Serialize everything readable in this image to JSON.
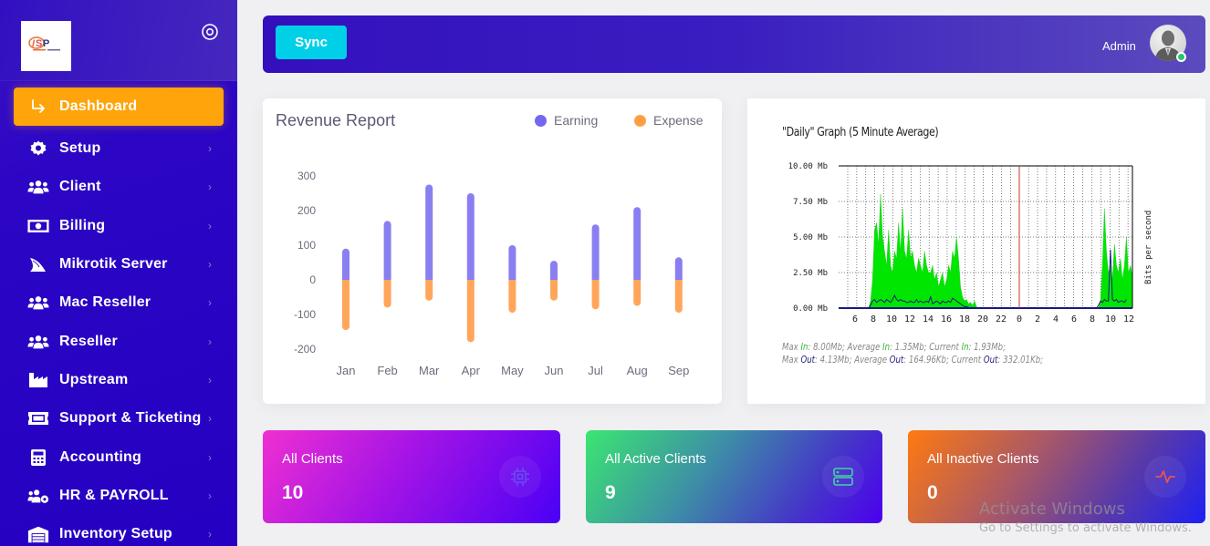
{
  "sidebar": {
    "logo_alt": "ISP Digital BD",
    "logo_text": "ISP",
    "items": [
      {
        "label": "Dashboard",
        "icon": "arrow-turn-down-right-icon",
        "active": true
      },
      {
        "label": "Setup",
        "icon": "gear-icon",
        "active": false
      },
      {
        "label": "Client",
        "icon": "users-icon",
        "active": false
      },
      {
        "label": "Billing",
        "icon": "money-bill-icon",
        "active": false
      },
      {
        "label": "Mikrotik Server",
        "icon": "sail-icon",
        "active": false
      },
      {
        "label": "Mac Reseller",
        "icon": "users-icon",
        "active": false
      },
      {
        "label": "Reseller",
        "icon": "users-icon",
        "active": false
      },
      {
        "label": "Upstream",
        "icon": "industry-icon",
        "active": false
      },
      {
        "label": "Support & Ticketing",
        "icon": "ticket-icon",
        "active": false
      },
      {
        "label": "Accounting",
        "icon": "calculator-icon",
        "active": false
      },
      {
        "label": "HR & PAYROLL",
        "icon": "users-cog-icon",
        "active": false
      },
      {
        "label": "Inventory Setup",
        "icon": "warehouse-icon",
        "active": false
      }
    ],
    "chevron": "›"
  },
  "topbar": {
    "sync_label": "Sync",
    "user_name": "Admin",
    "user_status": "online",
    "status_color": "#28c76f"
  },
  "revenue": {
    "title": "Revenue Report",
    "legend": [
      {
        "label": "Earning",
        "color": "#7367f0"
      },
      {
        "label": "Expense",
        "color": "#ff9f43"
      }
    ]
  },
  "chart_data": [
    {
      "type": "bar",
      "title": "Revenue Report",
      "xlabel": "",
      "ylabel": "",
      "categories": [
        "Jan",
        "Feb",
        "Mar",
        "Apr",
        "May",
        "Jun",
        "Jul",
        "Aug",
        "Sep"
      ],
      "series": [
        {
          "name": "Earning",
          "color": "#8a7ff0",
          "values": [
            90,
            170,
            275,
            250,
            100,
            55,
            160,
            210,
            65
          ]
        },
        {
          "name": "Expense",
          "color": "#ffa65b",
          "values": [
            -145,
            -80,
            -60,
            -180,
            -95,
            -60,
            -85,
            -75,
            -95
          ]
        }
      ],
      "yticks": [
        300,
        200,
        100,
        0,
        -100,
        -200
      ],
      "ylim": [
        -200,
        300
      ],
      "stacked": true,
      "grid": false,
      "legend": "top-right"
    },
    {
      "type": "area",
      "title": "\"Daily\" Graph (5 Minute Average)",
      "ylabel": "Bits per second",
      "yticks": [
        "10.00 Mb",
        "7.50 Mb",
        "5.00 Mb",
        "2.50 Mb",
        "0.00 Mb"
      ],
      "ylim": [
        0,
        10
      ],
      "xticks": [
        "6",
        "8",
        "10",
        "12",
        "14",
        "16",
        "18",
        "20",
        "22",
        "0",
        "2",
        "4",
        "6",
        "8",
        "10",
        "12"
      ],
      "grid": true,
      "marker_at": "0",
      "series": [
        {
          "name": "In",
          "color": "#00e600",
          "unit": "Mb",
          "values": [
            0,
            0,
            0,
            0,
            0,
            0,
            0,
            0,
            0,
            0,
            0,
            0,
            0,
            0,
            0,
            0,
            0.5,
            2,
            5.5,
            6,
            4.5,
            8,
            5,
            4,
            3,
            5.5,
            3,
            2.5,
            4,
            3.5,
            6,
            4,
            7,
            4,
            3.5,
            5.5,
            3.5,
            4,
            3,
            2.5,
            3.5,
            3,
            2.5,
            4,
            3,
            2.5,
            2.5,
            3,
            2,
            2.5,
            1.5,
            2,
            2.5,
            1.5,
            2,
            3,
            2.5,
            4,
            3.5,
            5,
            3.5,
            1.5,
            0.8,
            0.5,
            0.6,
            0.3,
            0.4,
            0.2,
            0.5,
            0.1,
            0,
            0,
            0,
            0,
            0,
            0,
            0,
            0,
            0,
            0,
            0,
            0,
            0,
            0,
            0,
            0,
            0,
            0,
            0,
            0,
            0,
            0,
            0,
            0,
            0,
            0,
            0,
            0,
            0,
            0,
            0,
            0,
            0,
            0,
            0,
            0,
            0,
            0,
            0,
            0,
            0,
            0,
            0,
            0,
            0,
            0,
            0,
            0,
            0,
            0,
            0,
            0,
            0,
            0,
            0,
            0,
            0,
            0,
            0,
            0,
            0,
            0.5,
            3,
            7,
            4,
            2.5,
            3,
            2,
            4.5,
            3,
            2.5,
            3.5,
            2,
            3,
            5,
            2.5,
            3,
            2.2
          ]
        },
        {
          "name": "Out",
          "color": "#1a1a80",
          "unit": "Mb",
          "values": [
            0,
            0,
            0,
            0,
            0,
            0,
            0,
            0,
            0,
            0,
            0,
            0,
            0,
            0,
            0,
            0,
            0.2,
            0.5,
            0.6,
            0.4,
            0.5,
            0.6,
            0.5,
            0.4,
            0.6,
            0.5,
            0.4,
            0.6,
            0.9,
            0.6,
            0.5,
            0.6,
            0.5,
            0.5,
            0.4,
            0.4,
            0.5,
            0.4,
            0.4,
            0.6,
            0.4,
            0.5,
            0.4,
            0.4,
            0.5,
            0.4,
            0.8,
            0.3,
            0.4,
            0.5,
            0.4,
            0.3,
            0.5,
            0.4,
            0.4,
            0.5,
            0.4,
            0.7,
            0.6,
            0.5,
            0.4,
            0.3,
            0.2,
            0.1,
            0.1,
            0.05,
            0,
            0,
            0,
            0,
            0,
            0,
            0,
            0,
            0,
            0,
            0,
            0,
            0,
            0,
            0,
            0,
            0,
            0,
            0,
            0,
            0,
            0,
            0,
            0,
            0,
            0,
            0,
            0,
            0,
            0,
            0,
            0,
            0,
            0,
            0,
            0,
            0,
            0,
            0,
            0,
            0,
            0,
            0,
            0,
            0,
            0,
            0,
            0,
            0,
            0,
            0,
            0,
            0,
            0,
            0,
            0,
            0,
            0,
            0,
            0,
            0,
            0,
            0,
            0,
            0.2,
            0.5,
            0.4,
            0.6,
            0.5,
            0.5,
            4.1,
            0.6,
            0.5,
            0.6,
            0.4,
            0.5,
            0.5,
            0.4,
            0.6
          ]
        }
      ]
    }
  ],
  "mrtg": {
    "title": "\"Daily\" Graph (5 Minute Average)",
    "ylabel": "Bits per second",
    "stats": {
      "max_in": "8.00Mb",
      "avg_in": "1.35Mb",
      "cur_in": "1.93Mb",
      "max_out": "4.13Mb",
      "avg_out": "164.96Kb",
      "cur_out": "332.01Kb"
    },
    "labels": {
      "max": "Max",
      "average": "Average",
      "current": "Current",
      "in": "In",
      "out": "Out"
    }
  },
  "stats": [
    {
      "label": "All Clients",
      "value": "10",
      "icon": "cpu-icon",
      "icon_color": "#6a4df0"
    },
    {
      "label": "All Active Clients",
      "value": "9",
      "icon": "server-icon",
      "icon_color": "#3fd4a0"
    },
    {
      "label": "All Inactive Clients",
      "value": "0",
      "icon": "activity-icon",
      "icon_color": "#ea5455"
    }
  ],
  "watermark": {
    "line1": "Activate Windows",
    "line2": "Go to Settings to activate Windows."
  }
}
